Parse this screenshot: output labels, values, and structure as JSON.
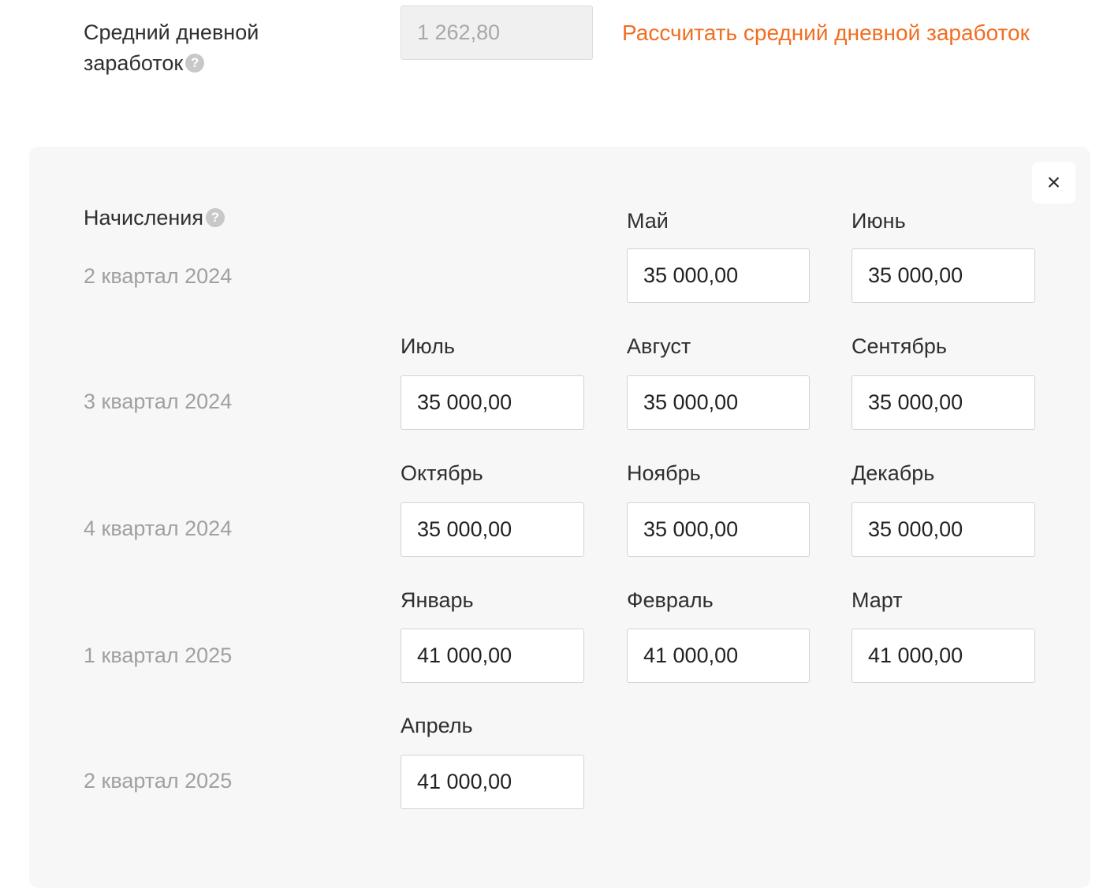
{
  "avg_daily": {
    "label_line1": "Средний дневной",
    "label_line2": "заработок",
    "value": "1 262,80",
    "calc_link": "Рассчитать средний дневной заработок",
    "help": "?"
  },
  "accruals": {
    "title": "Начисления",
    "help": "?",
    "close": "×",
    "quarters": [
      {
        "label": "2 квартал 2024",
        "months": [
          {
            "name": "Май",
            "value": "35 000,00"
          },
          {
            "name": "Июнь",
            "value": "35 000,00"
          }
        ]
      },
      {
        "label": "3 квартал 2024",
        "months": [
          {
            "name": "Июль",
            "value": "35 000,00"
          },
          {
            "name": "Август",
            "value": "35 000,00"
          },
          {
            "name": "Сентябрь",
            "value": "35 000,00"
          }
        ]
      },
      {
        "label": "4 квартал 2024",
        "months": [
          {
            "name": "Октябрь",
            "value": "35 000,00"
          },
          {
            "name": "Ноябрь",
            "value": "35 000,00"
          },
          {
            "name": "Декабрь",
            "value": "35 000,00"
          }
        ]
      },
      {
        "label": "1 квартал 2025",
        "months": [
          {
            "name": "Январь",
            "value": "41 000,00"
          },
          {
            "name": "Февраль",
            "value": "41 000,00"
          },
          {
            "name": "Март",
            "value": "41 000,00"
          }
        ]
      },
      {
        "label": "2 квартал 2025",
        "months": [
          {
            "name": "Апрель",
            "value": "41 000,00"
          }
        ]
      }
    ]
  },
  "colors": {
    "accent": "#f26d21",
    "panel_bg": "#f8f7f7",
    "muted_text": "#a0a0a0"
  }
}
